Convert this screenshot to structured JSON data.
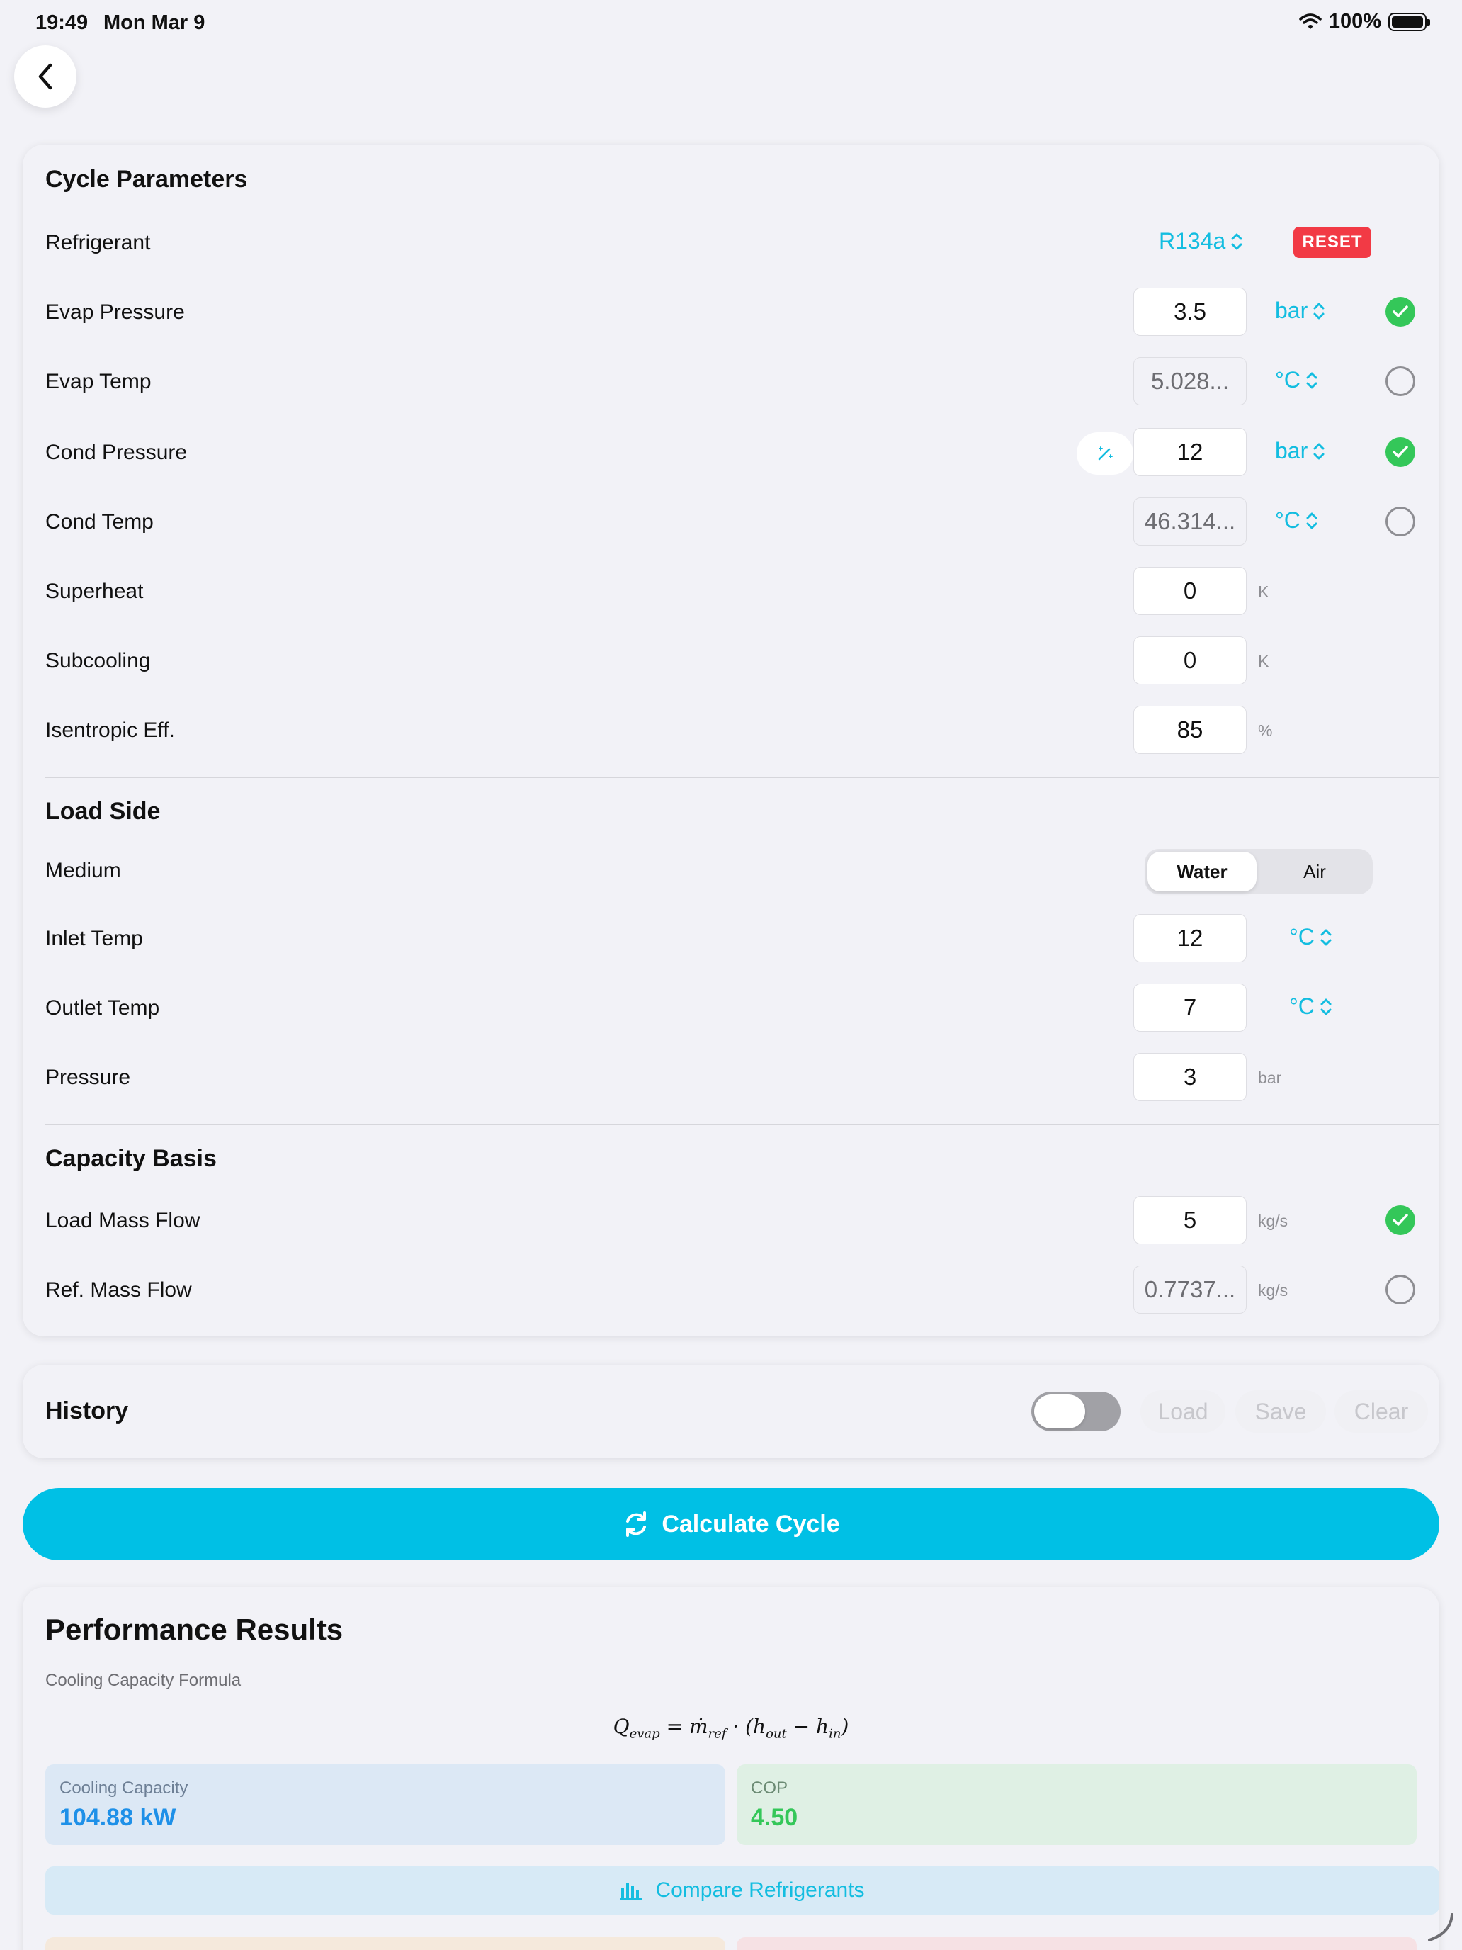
{
  "status": {
    "time": "19:49",
    "date": "Mon Mar 9",
    "battery": "100%"
  },
  "params": {
    "title": "Cycle Parameters",
    "refrigerant": {
      "label": "Refrigerant",
      "value": "R134a",
      "reset": "RESET"
    },
    "evap_pressure": {
      "label": "Evap Pressure",
      "value": "3.5",
      "unit": "bar",
      "checked": true
    },
    "evap_temp": {
      "label": "Evap Temp",
      "value": "5.028...",
      "unit": "°C",
      "checked": false
    },
    "cond_pressure": {
      "label": "Cond Pressure",
      "value": "12",
      "unit": "bar",
      "checked": true
    },
    "cond_temp": {
      "label": "Cond Temp",
      "value": "46.314...",
      "unit": "°C",
      "checked": false
    },
    "superheat": {
      "label": "Superheat",
      "value": "0",
      "unit": "K"
    },
    "subcooling": {
      "label": "Subcooling",
      "value": "0",
      "unit": "K"
    },
    "isentropic": {
      "label": "Isentropic Eff.",
      "value": "85",
      "unit": "%"
    }
  },
  "load": {
    "title": "Load Side",
    "medium": {
      "label": "Medium",
      "options": [
        "Water",
        "Air"
      ],
      "selected": "Water"
    },
    "inlet": {
      "label": "Inlet Temp",
      "value": "12",
      "unit": "°C"
    },
    "outlet": {
      "label": "Outlet Temp",
      "value": "7",
      "unit": "°C"
    },
    "pressure": {
      "label": "Pressure",
      "value": "3",
      "unit": "bar"
    }
  },
  "capacity": {
    "title": "Capacity Basis",
    "load_flow": {
      "label": "Load Mass Flow",
      "value": "5",
      "unit": "kg/s",
      "checked": true
    },
    "ref_flow": {
      "label": "Ref. Mass Flow",
      "value": "0.7737...",
      "unit": "kg/s",
      "checked": false
    }
  },
  "history": {
    "title": "History",
    "toggle_on": false,
    "load": "Load",
    "save": "Save",
    "clear": "Clear"
  },
  "calculate": {
    "label": "Calculate Cycle"
  },
  "results": {
    "title": "Performance Results",
    "formula_label": "Cooling Capacity Formula",
    "cooling": {
      "label": "Cooling Capacity",
      "value": "104.88 kW"
    },
    "cop": {
      "label": "COP",
      "value": "4.50"
    },
    "compare": "Compare Refrigerants"
  },
  "colors": {
    "accent": "#00c0e5",
    "check": "#34c759",
    "reset": "#f23a45",
    "cooling_bg": "#dce8f5",
    "cop_bg": "#dff0e4"
  }
}
